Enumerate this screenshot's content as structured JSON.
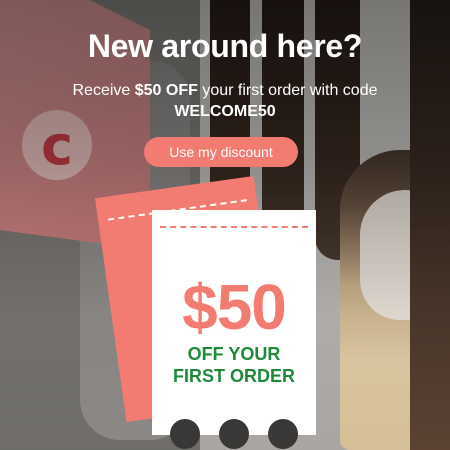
{
  "popup": {
    "headline": "New around here?",
    "subtext": {
      "part1": "Receive ",
      "bold_amount": "$50 OFF",
      "part2": " your first order with code ",
      "bold_code": "WELCOME50"
    },
    "cta_label": "Use my discount"
  },
  "coupon": {
    "amount": "$50",
    "line1": "OFF YOUR",
    "line2": "FIRST ORDER"
  },
  "background": {
    "bag_logo_letter": "c"
  },
  "colors": {
    "accent": "#f27b72",
    "offer_text": "#1f8a3a",
    "headline": "#ffffff"
  }
}
